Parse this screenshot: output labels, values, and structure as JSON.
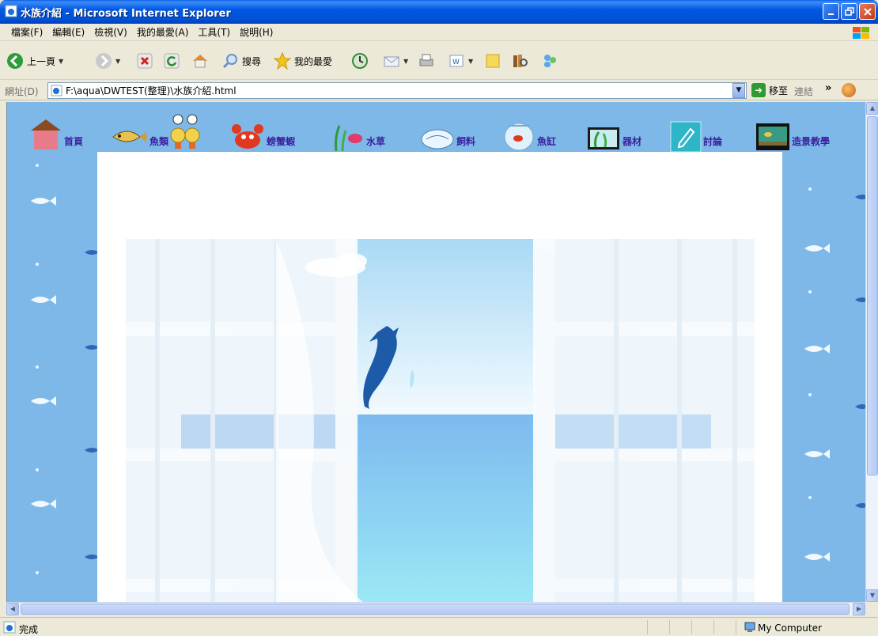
{
  "window": {
    "title": "水族介紹 - Microsoft Internet Explorer",
    "icon": "ie-page-icon"
  },
  "menu": {
    "items": [
      "檔案(F)",
      "編輯(E)",
      "檢視(V)",
      "我的最愛(A)",
      "工具(T)",
      "說明(H)"
    ]
  },
  "toolbar": {
    "back_label": "上一頁",
    "search_label": "搜尋",
    "favorites_label": "我的最愛"
  },
  "address": {
    "label": "網址(D)",
    "value": "F:\\aqua\\DWTEST(整理)\\水族介紹.html",
    "go_label": "移至",
    "links_label": "連結"
  },
  "site_nav": {
    "items": [
      {
        "label": "首頁",
        "icon": "house-icon"
      },
      {
        "label": "魚類",
        "icon": "fish-icon"
      },
      {
        "label": "螃蟹蝦",
        "icon": "crab-icon"
      },
      {
        "label": "水草",
        "icon": "waterplant-icon"
      },
      {
        "label": "飼料",
        "icon": "feed-icon"
      },
      {
        "label": "魚缸",
        "icon": "fishbowl-icon"
      },
      {
        "label": "器材",
        "icon": "equipment-icon"
      },
      {
        "label": "討論",
        "icon": "pencil-icon"
      },
      {
        "label": "造景教學",
        "icon": "aquarium-icon"
      }
    ]
  },
  "status": {
    "text": "完成",
    "zone": "My Computer"
  },
  "colors": {
    "titlebar": "#0058e6",
    "page_background": "#7db8e8",
    "nav_text": "#3b1f9e"
  }
}
